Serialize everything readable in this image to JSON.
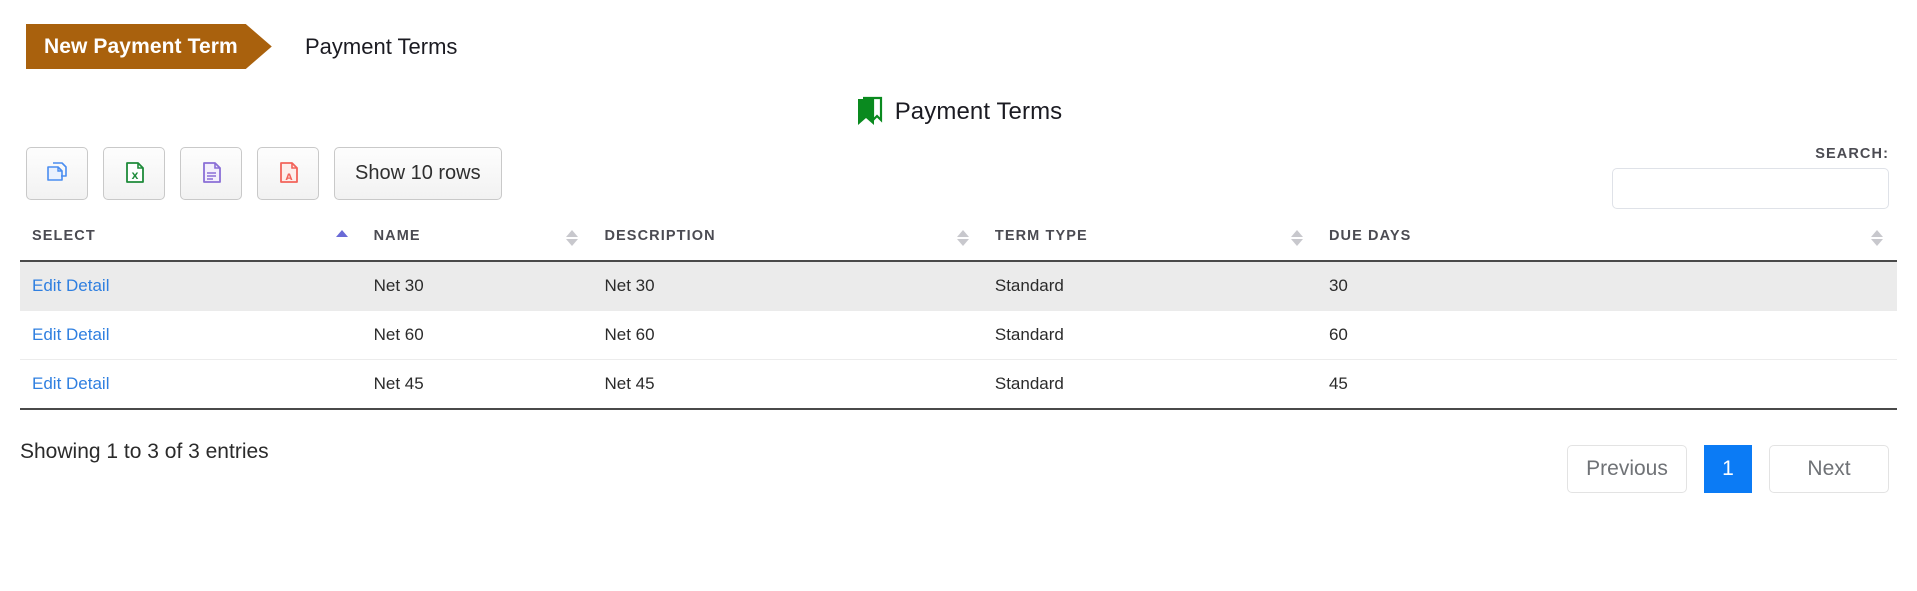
{
  "breadcrumb": {
    "action_label": "New Payment Term",
    "current_label": "Payment Terms",
    "accent_color": "#a9610d"
  },
  "heading": {
    "title": "Payment Terms",
    "icon": "bookmark-icon",
    "icon_color": "#0a8a1f"
  },
  "toolbar": {
    "buttons": [
      {
        "name": "copy",
        "icon": "copy-icon",
        "color": "#4a8df0"
      },
      {
        "name": "excel",
        "icon": "excel-file-icon",
        "color": "#1e8b3a"
      },
      {
        "name": "csv",
        "icon": "text-file-icon",
        "color": "#8a6fd6"
      },
      {
        "name": "pdf",
        "icon": "pdf-file-icon",
        "color": "#f2635a"
      }
    ],
    "rows_label": "Show 10 rows"
  },
  "search": {
    "label": "SEARCH:",
    "value": "",
    "placeholder": ""
  },
  "table": {
    "columns": [
      {
        "label": "SELECT",
        "sort": "asc"
      },
      {
        "label": "NAME",
        "sort": "none"
      },
      {
        "label": "DESCRIPTION",
        "sort": "none"
      },
      {
        "label": "TERM TYPE",
        "sort": "none"
      },
      {
        "label": "DUE DAYS",
        "sort": "none"
      }
    ],
    "rows": [
      {
        "select": "Edit Detail",
        "name": "Net 30",
        "description": "Net 30",
        "term_type": "Standard",
        "due_days": "30"
      },
      {
        "select": "Edit Detail",
        "name": "Net 60",
        "description": "Net 60",
        "term_type": "Standard",
        "due_days": "60"
      },
      {
        "select": "Edit Detail",
        "name": "Net 45",
        "description": "Net 45",
        "term_type": "Standard",
        "due_days": "45"
      }
    ]
  },
  "footer": {
    "showing": "Showing 1 to 3 of 3 entries",
    "previous_label": "Previous",
    "page_label": "1",
    "next_label": "Next",
    "active_color": "#0b7bf5"
  }
}
